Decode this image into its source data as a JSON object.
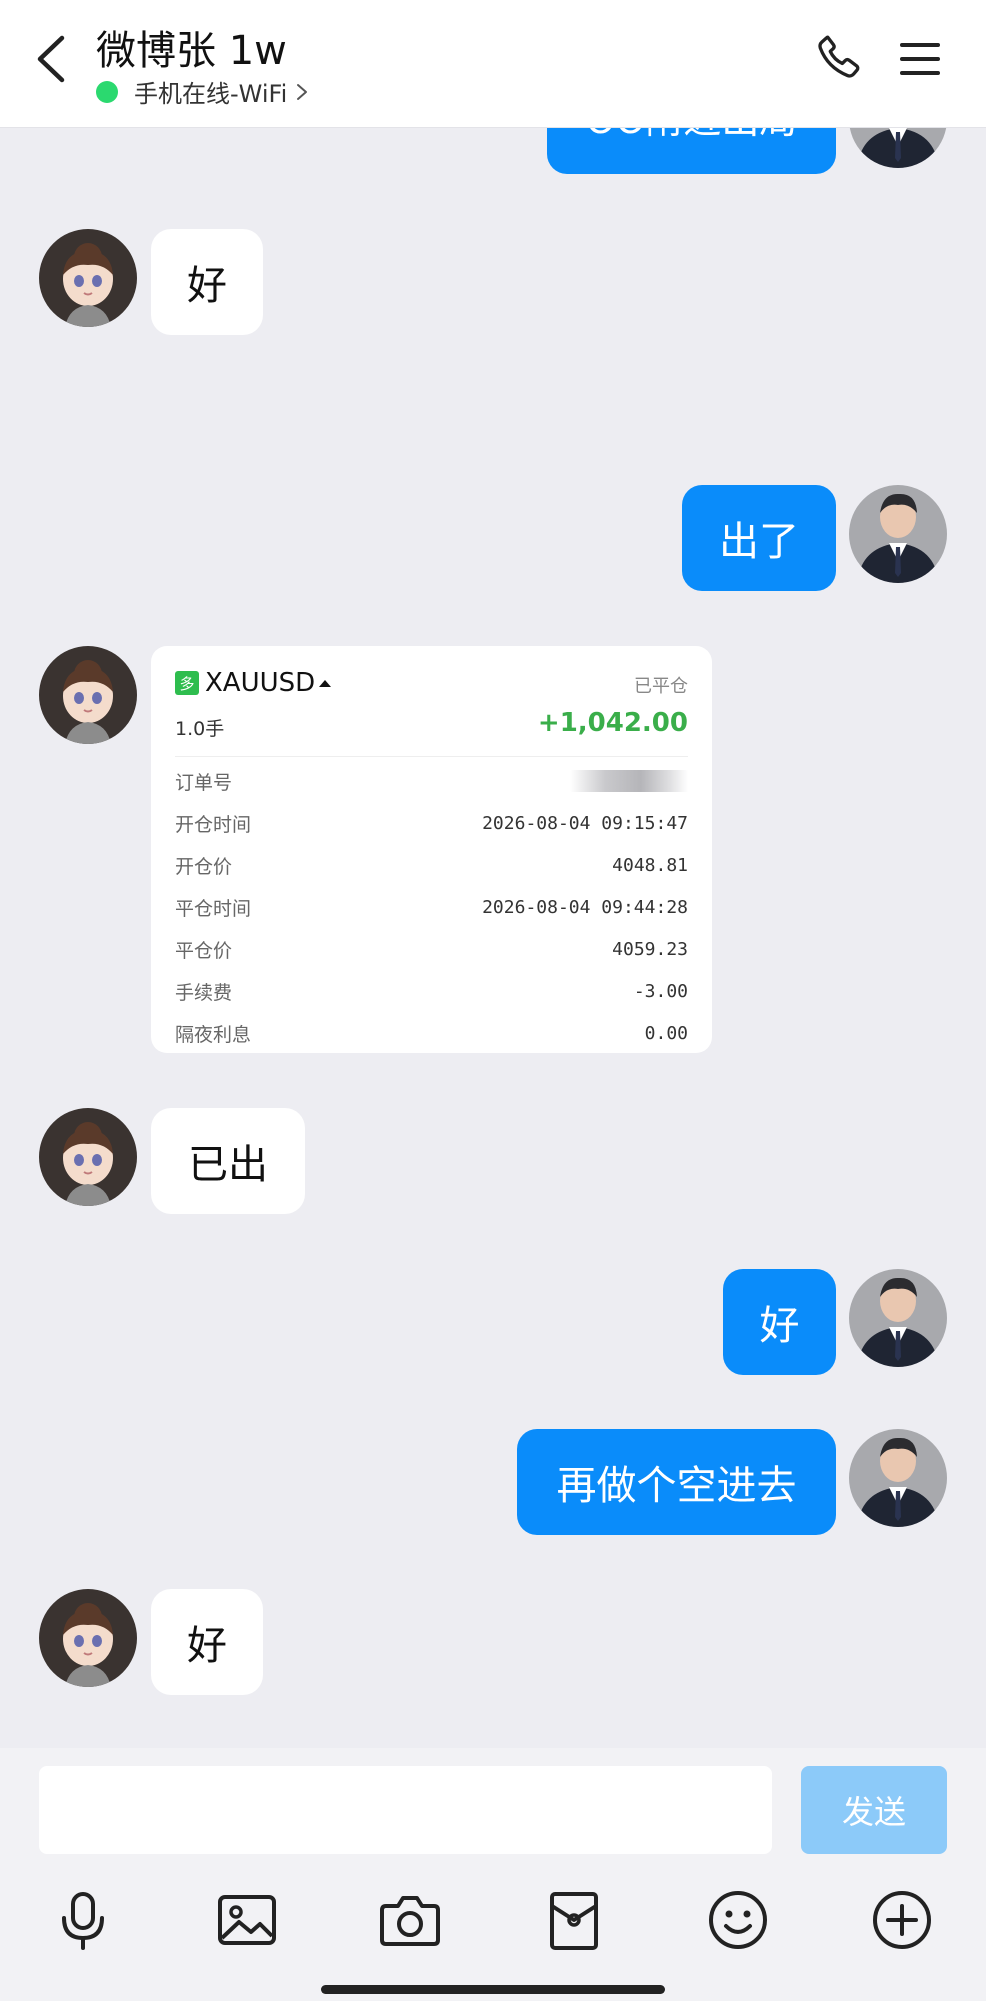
{
  "header": {
    "title": "微博张 1w",
    "status_text": "手机在线-WiFi",
    "online_color": "#2bd96f"
  },
  "chat": {
    "partial_message": "OO附近出局",
    "messages": [
      {
        "side": "in",
        "text": "好"
      },
      {
        "side": "out",
        "text": "出了"
      },
      {
        "side": "in",
        "type": "trade_card"
      },
      {
        "side": "in",
        "text": "已出"
      },
      {
        "side": "out",
        "text": "好"
      },
      {
        "side": "out",
        "text": "再做个空进去"
      },
      {
        "side": "in",
        "text": "好"
      }
    ]
  },
  "trade": {
    "direction_badge": "多",
    "symbol": "XAUUSD",
    "status": "已平仓",
    "lots": "1.0手",
    "profit": "+1,042.00",
    "details": [
      {
        "label": "订单号",
        "value": ""
      },
      {
        "label": "开仓时间",
        "value": "2026-08-04 09:15:47"
      },
      {
        "label": "开仓价",
        "value": "4048.81"
      },
      {
        "label": "平仓时间",
        "value": "2026-08-04 09:44:28"
      },
      {
        "label": "平仓价",
        "value": "4059.23"
      },
      {
        "label": "手续费",
        "value": "-3.00"
      },
      {
        "label": "隔夜利息",
        "value": "0.00"
      }
    ]
  },
  "input": {
    "placeholder": "",
    "send_label": "发送"
  },
  "toolbar": {
    "icons": [
      "microphone-icon",
      "image-icon",
      "camera-icon",
      "red-packet-icon",
      "emoji-icon",
      "plus-icon"
    ]
  },
  "colors": {
    "outgoing_bubble": "#0a8cfa",
    "incoming_bubble": "#ffffff",
    "background": "#ededf2",
    "profit": "#3aae4a",
    "send_button": "#8ccaf9"
  }
}
